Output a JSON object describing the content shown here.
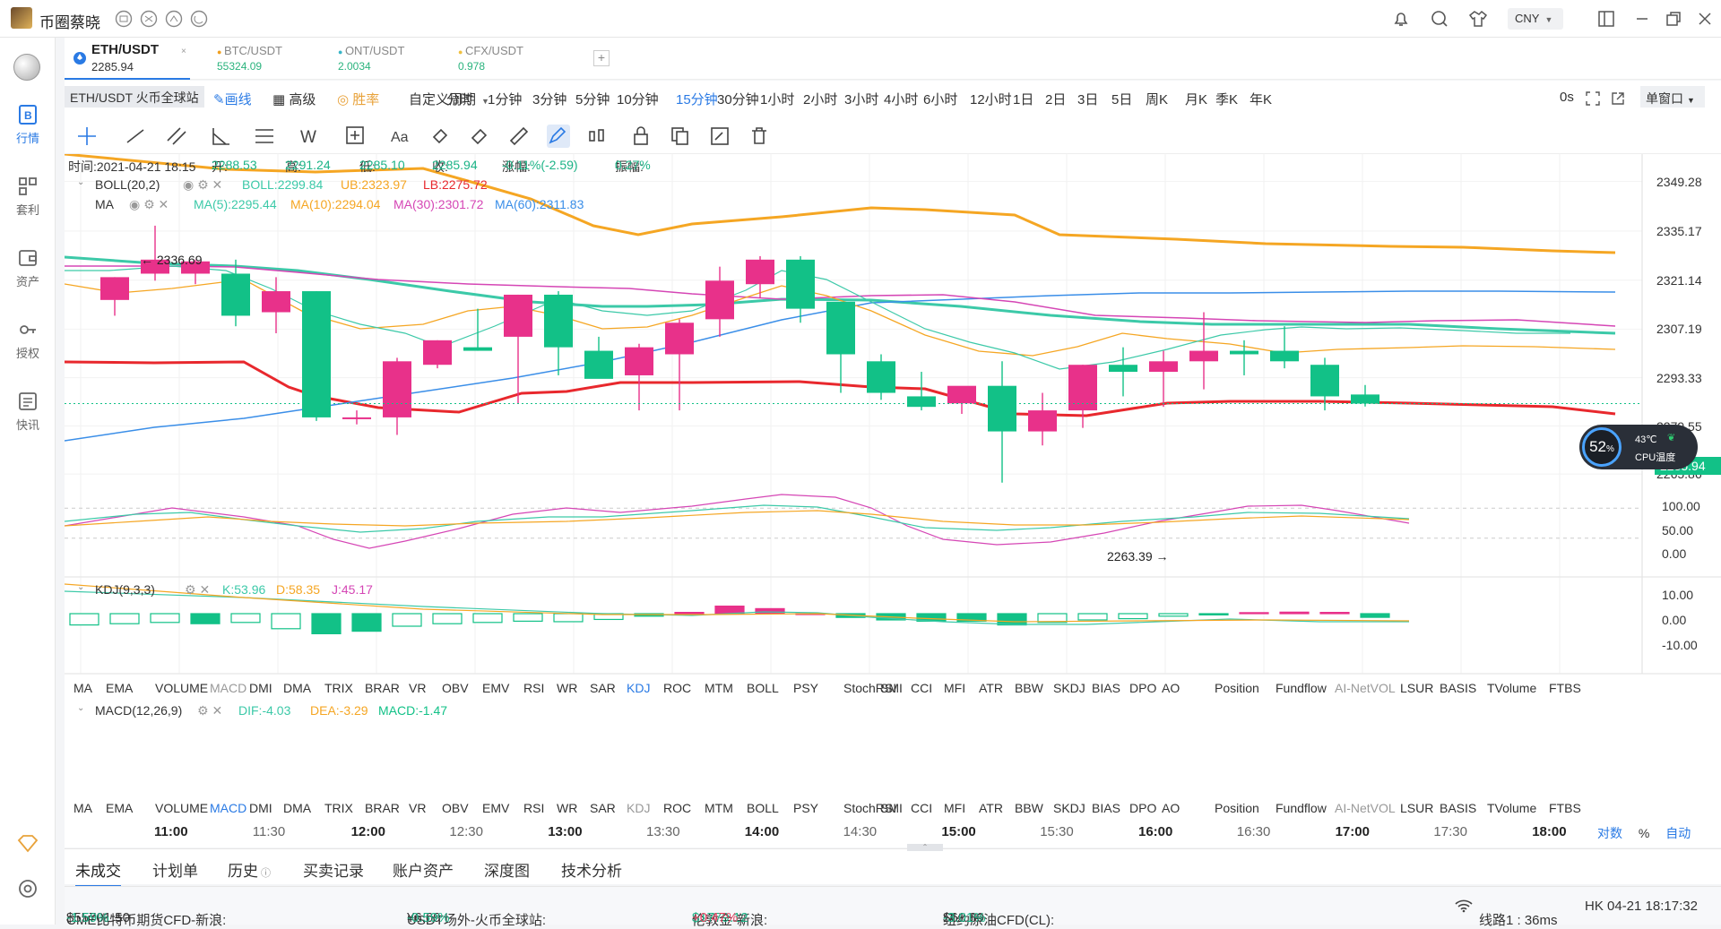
{
  "app": {
    "title": "币圈蔡晓",
    "currency": "CNY"
  },
  "sidebar": {
    "items": [
      {
        "label": "行情"
      },
      {
        "label": "套利"
      },
      {
        "label": "资产"
      },
      {
        "label": "授权"
      },
      {
        "label": "快讯"
      }
    ]
  },
  "pair_tabs": [
    {
      "name": "ETH/USDT",
      "price": "2285.94"
    },
    {
      "name": "BTC/USDT",
      "price": "55324.09"
    },
    {
      "name": "ONT/USDT",
      "price": "2.0034"
    },
    {
      "name": "CFX/USDT",
      "price": "0.978"
    }
  ],
  "exchange_label": "ETH/USDT 火币全球站",
  "toolbar": {
    "draw": "画线",
    "advanced": "高级",
    "winrate": "胜率",
    "custom_period": "自定义周期",
    "intervals": [
      "分时",
      "1分钟",
      "3分钟",
      "5分钟",
      "10分钟",
      "15分钟",
      "30分钟",
      "1小时",
      "2小时",
      "3小时",
      "4小时",
      "6小时",
      "12小时",
      "1日",
      "2日",
      "3日",
      "5日",
      "周K",
      "月K",
      "季K",
      "年K"
    ],
    "active_interval": "15分钟",
    "countdown": "0s",
    "window_mode": "单窗口"
  },
  "ohlc_info": {
    "time": "时间:2021-04-21 18:15",
    "open_label": "开:",
    "open": "2288.53",
    "high_label": "高:",
    "high": "2291.24",
    "low_label": "低:",
    "low": "2285.10",
    "close_label": "收:",
    "close": "2285.94",
    "change_label": "涨幅:",
    "change": "-0.11%(-2.59)",
    "amp_label": "振幅:",
    "amp": "0.27%"
  },
  "boll": {
    "name": "BOLL(20,2)",
    "mid": "BOLL:2299.84",
    "ub": "UB:2323.97",
    "lb": "LB:2275.72"
  },
  "ma": {
    "name": "MA",
    "ma5": "MA(5):2295.44",
    "ma10": "MA(10):2294.04",
    "ma30": "MA(30):2301.72",
    "ma60": "MA(60):2311.83"
  },
  "price_axis": [
    "2349.28",
    "2335.17",
    "2321.14",
    "2307.19",
    "2293.33",
    "2279.55",
    "2265.86"
  ],
  "current_price": "2285.94",
  "high_annotation": "← 2336.69",
  "low_annotation": "2263.39 →",
  "cpu": {
    "percent": "52",
    "unit": "%",
    "temp": "43℃",
    "label": "CPU温度"
  },
  "kdj": {
    "name": "KDJ(9,3,3)",
    "k": "K:53.96",
    "d": "D:58.35",
    "j": "J:45.17",
    "axis": [
      "100.00",
      "50.00",
      "0.00"
    ]
  },
  "macd": {
    "name": "MACD(12,26,9)",
    "dif": "DIF:-4.03",
    "dea": "DEA:-3.29",
    "macd": "MACD:-1.47",
    "axis": [
      "10.00",
      "0.00",
      "-10.00"
    ]
  },
  "indicator_list": [
    "MA",
    "EMA",
    "VOLUME",
    "MACD",
    "DMI",
    "DMA",
    "TRIX",
    "BRAR",
    "VR",
    "OBV",
    "EMV",
    "RSI",
    "WR",
    "SAR",
    "KDJ",
    "ROC",
    "MTM",
    "BOLL",
    "PSY",
    "StochRSI",
    "SMI",
    "CCI",
    "MFI",
    "ATR",
    "BBW",
    "SKDJ",
    "BIAS",
    "DPO",
    "AO",
    "Position",
    "Fundflow",
    "AI-NetVOL",
    "LSUR",
    "BASIS",
    "TVolume",
    "FTBS"
  ],
  "time_axis": [
    "11:00",
    "11:30",
    "12:00",
    "12:30",
    "13:00",
    "13:30",
    "14:00",
    "14:30",
    "15:00",
    "15:30",
    "16:00",
    "16:30",
    "17:00",
    "17:30",
    "18:00"
  ],
  "axis_modes": [
    "对数",
    "%",
    "自动"
  ],
  "bottom_tabs": [
    "未成交",
    "计划单",
    "历史",
    "买卖记录",
    "账户资产",
    "深度图",
    "技术分析"
  ],
  "status": {
    "tickers": [
      {
        "label": "CME比特币期货CFD-新浪:",
        "price": "$55701.50",
        "change": "-1.59%",
        "dir": "down"
      },
      {
        "label": "USDT场外-火币全球站:",
        "price": "¥6.69",
        "change": "-0.59%",
        "dir": "down"
      },
      {
        "label": "伦敦金-新浪:",
        "price": "$1779.12",
        "change": "+0.47%",
        "dir": "up"
      },
      {
        "label": "纽约原油CFD(CL):",
        "price": "$61.80",
        "change": "-3.01%",
        "dir": "down"
      }
    ],
    "line": "线路1 : 36ms",
    "clock": "HK 04-21 18:17:32"
  },
  "colors": {
    "up": "#e8318a",
    "down": "#12c187",
    "boll_ub": "#f5a623",
    "boll_lb": "#e8282d",
    "boll_mid": "#3cc9a8",
    "accent": "#2a7ae4"
  },
  "chart_data": {
    "type": "candlestick",
    "candles": [
      {
        "t": "10:45",
        "o": 2315.5,
        "h": 2322,
        "l": 2311,
        "c": 2322
      },
      {
        "t": "11:00",
        "o": 2323,
        "h": 2336.69,
        "l": 2321,
        "c": 2327
      },
      {
        "t": "11:00b",
        "o": 2323,
        "h": 2327,
        "l": 2320,
        "c": 2326.5
      },
      {
        "t": "11:15",
        "o": 2323,
        "h": 2327,
        "l": 2308,
        "c": 2311
      },
      {
        "t": "11:30",
        "o": 2312,
        "h": 2322,
        "l": 2306,
        "c": 2318
      },
      {
        "t": "11:45",
        "o": 2318,
        "h": 2318,
        "l": 2281,
        "c": 2282
      },
      {
        "t": "12:00",
        "o": 2282,
        "h": 2284,
        "l": 2280,
        "c": 2282
      },
      {
        "t": "12:15",
        "o": 2282,
        "h": 2299,
        "l": 2277,
        "c": 2298
      },
      {
        "t": "12:30",
        "o": 2297,
        "h": 2304,
        "l": 2296,
        "c": 2304
      },
      {
        "t": "12:45",
        "o": 2302,
        "h": 2313,
        "l": 2301,
        "c": 2301
      },
      {
        "t": "13:00",
        "o": 2305,
        "h": 2317,
        "l": 2286,
        "c": 2317
      },
      {
        "t": "13:15",
        "o": 2317,
        "h": 2318,
        "l": 2294,
        "c": 2302
      },
      {
        "t": "13:30",
        "o": 2301,
        "h": 2305,
        "l": 2295,
        "c": 2293
      },
      {
        "t": "13:45",
        "o": 2294,
        "h": 2303,
        "l": 2284,
        "c": 2302
      },
      {
        "t": "14:00",
        "o": 2300,
        "h": 2310,
        "l": 2284,
        "c": 2309
      },
      {
        "t": "14:15",
        "o": 2310,
        "h": 2325,
        "l": 2305,
        "c": 2321
      },
      {
        "t": "14:30",
        "o": 2320,
        "h": 2328,
        "l": 2316,
        "c": 2327
      },
      {
        "t": "14:45",
        "o": 2327,
        "h": 2328,
        "l": 2309,
        "c": 2313
      },
      {
        "t": "15:00",
        "o": 2315,
        "h": 2315,
        "l": 2289,
        "c": 2300
      },
      {
        "t": "15:15",
        "o": 2298,
        "h": 2300,
        "l": 2287,
        "c": 2289
      },
      {
        "t": "15:30",
        "o": 2288,
        "h": 2295,
        "l": 2284,
        "c": 2285
      },
      {
        "t": "15:45",
        "o": 2286,
        "h": 2290,
        "l": 2283,
        "c": 2291
      },
      {
        "t": "16:00",
        "o": 2291,
        "h": 2298,
        "l": 2263.39,
        "c": 2278
      },
      {
        "t": "16:15",
        "o": 2278,
        "h": 2289,
        "l": 2274,
        "c": 2284
      },
      {
        "t": "16:30",
        "o": 2284,
        "h": 2297,
        "l": 2279,
        "c": 2297
      },
      {
        "t": "16:45",
        "o": 2297,
        "h": 2302,
        "l": 2288,
        "c": 2295
      },
      {
        "t": "17:00",
        "o": 2295,
        "h": 2301,
        "l": 2285,
        "c": 2298
      },
      {
        "t": "17:15",
        "o": 2298,
        "h": 2312,
        "l": 2290,
        "c": 2301
      },
      {
        "t": "17:30",
        "o": 2301,
        "h": 2304,
        "l": 2294,
        "c": 2300
      },
      {
        "t": "17:45",
        "o": 2301,
        "h": 2308,
        "l": 2296,
        "c": 2298
      },
      {
        "t": "18:00",
        "o": 2297,
        "h": 2299,
        "l": 2284,
        "c": 2288
      },
      {
        "t": "18:15",
        "o": 2288.53,
        "h": 2291.24,
        "l": 2285.1,
        "c": 2285.94
      }
    ],
    "ylim": [
      2260,
      2352
    ]
  }
}
